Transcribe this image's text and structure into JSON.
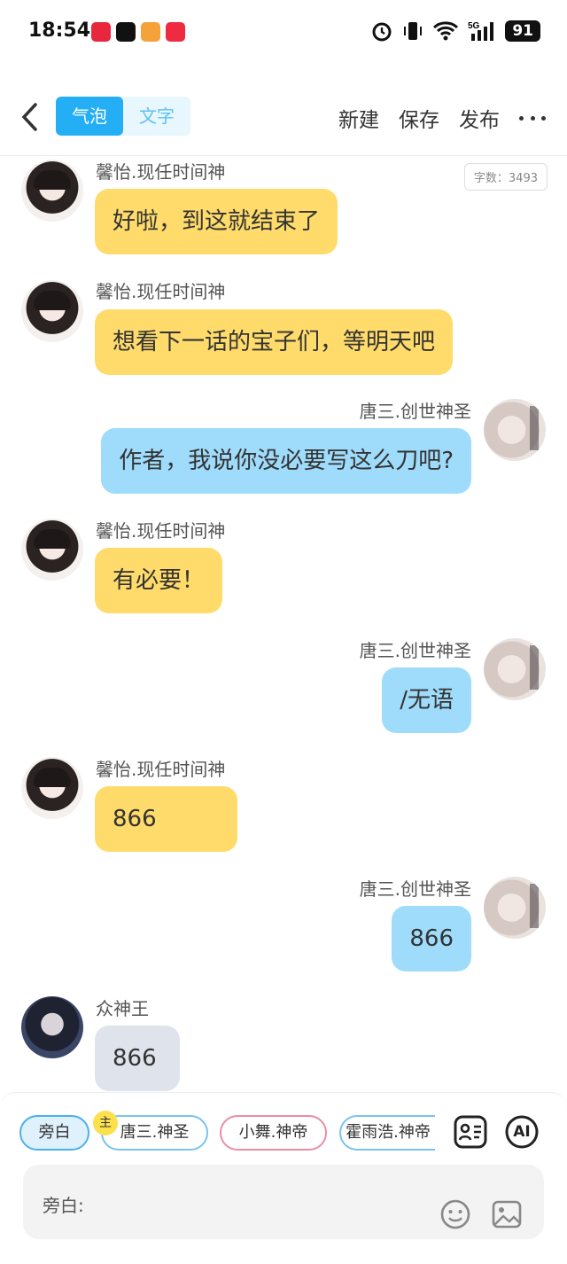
{
  "status": {
    "time": "18:54",
    "battery": "91",
    "net": "5G"
  },
  "header": {
    "back_icon": "chevron-left-icon",
    "tabs": [
      {
        "label": "气泡",
        "active": true
      },
      {
        "label": "文字",
        "active": false
      }
    ],
    "new_label": "新建",
    "save_label": "保存",
    "publish_label": "发布",
    "more_icon": "more-horizontal-icon"
  },
  "word_count": "字数：3493",
  "messages": [
    {
      "speaker": "馨怡.现任时间神",
      "text": "好啦，到这就结束了",
      "side": "left",
      "color": "#fedb6b"
    },
    {
      "speaker": "馨怡.现任时间神",
      "text": "想看下一话的宝子们，等明天吧",
      "side": "left",
      "color": "#fedb6b"
    },
    {
      "speaker": "唐三.创世神圣",
      "text": "作者，我说你没必要写这么刀吧?",
      "side": "right",
      "color": "#9fdcfb"
    },
    {
      "speaker": "馨怡.现任时间神",
      "text": "有必要！",
      "side": "left",
      "color": "#fedb6b"
    },
    {
      "speaker": "唐三.创世神圣",
      "text": "/无语",
      "side": "right",
      "color": "#9fdcfb"
    },
    {
      "speaker": "馨怡.现任时间神",
      "text": "866",
      "side": "left",
      "color": "#fedb6b"
    },
    {
      "speaker": "唐三.创世神圣",
      "text": "866",
      "side": "right",
      "color": "#9fdcfb"
    },
    {
      "speaker": "众神王",
      "text": "866",
      "side": "left",
      "color": "#dfe4ec"
    }
  ],
  "characters": [
    {
      "label": "旁白",
      "selected": true
    },
    {
      "label": "唐三.神圣",
      "badge": "主"
    },
    {
      "label": "小舞.神帝"
    },
    {
      "label": "霍雨浩.神帝"
    }
  ],
  "tools": {
    "role_icon": "role-card-icon",
    "ai_label": "AI"
  },
  "composer": {
    "label": "旁白:",
    "placeholder": "",
    "emoji_icon": "emoji-icon",
    "image_icon": "image-icon"
  }
}
